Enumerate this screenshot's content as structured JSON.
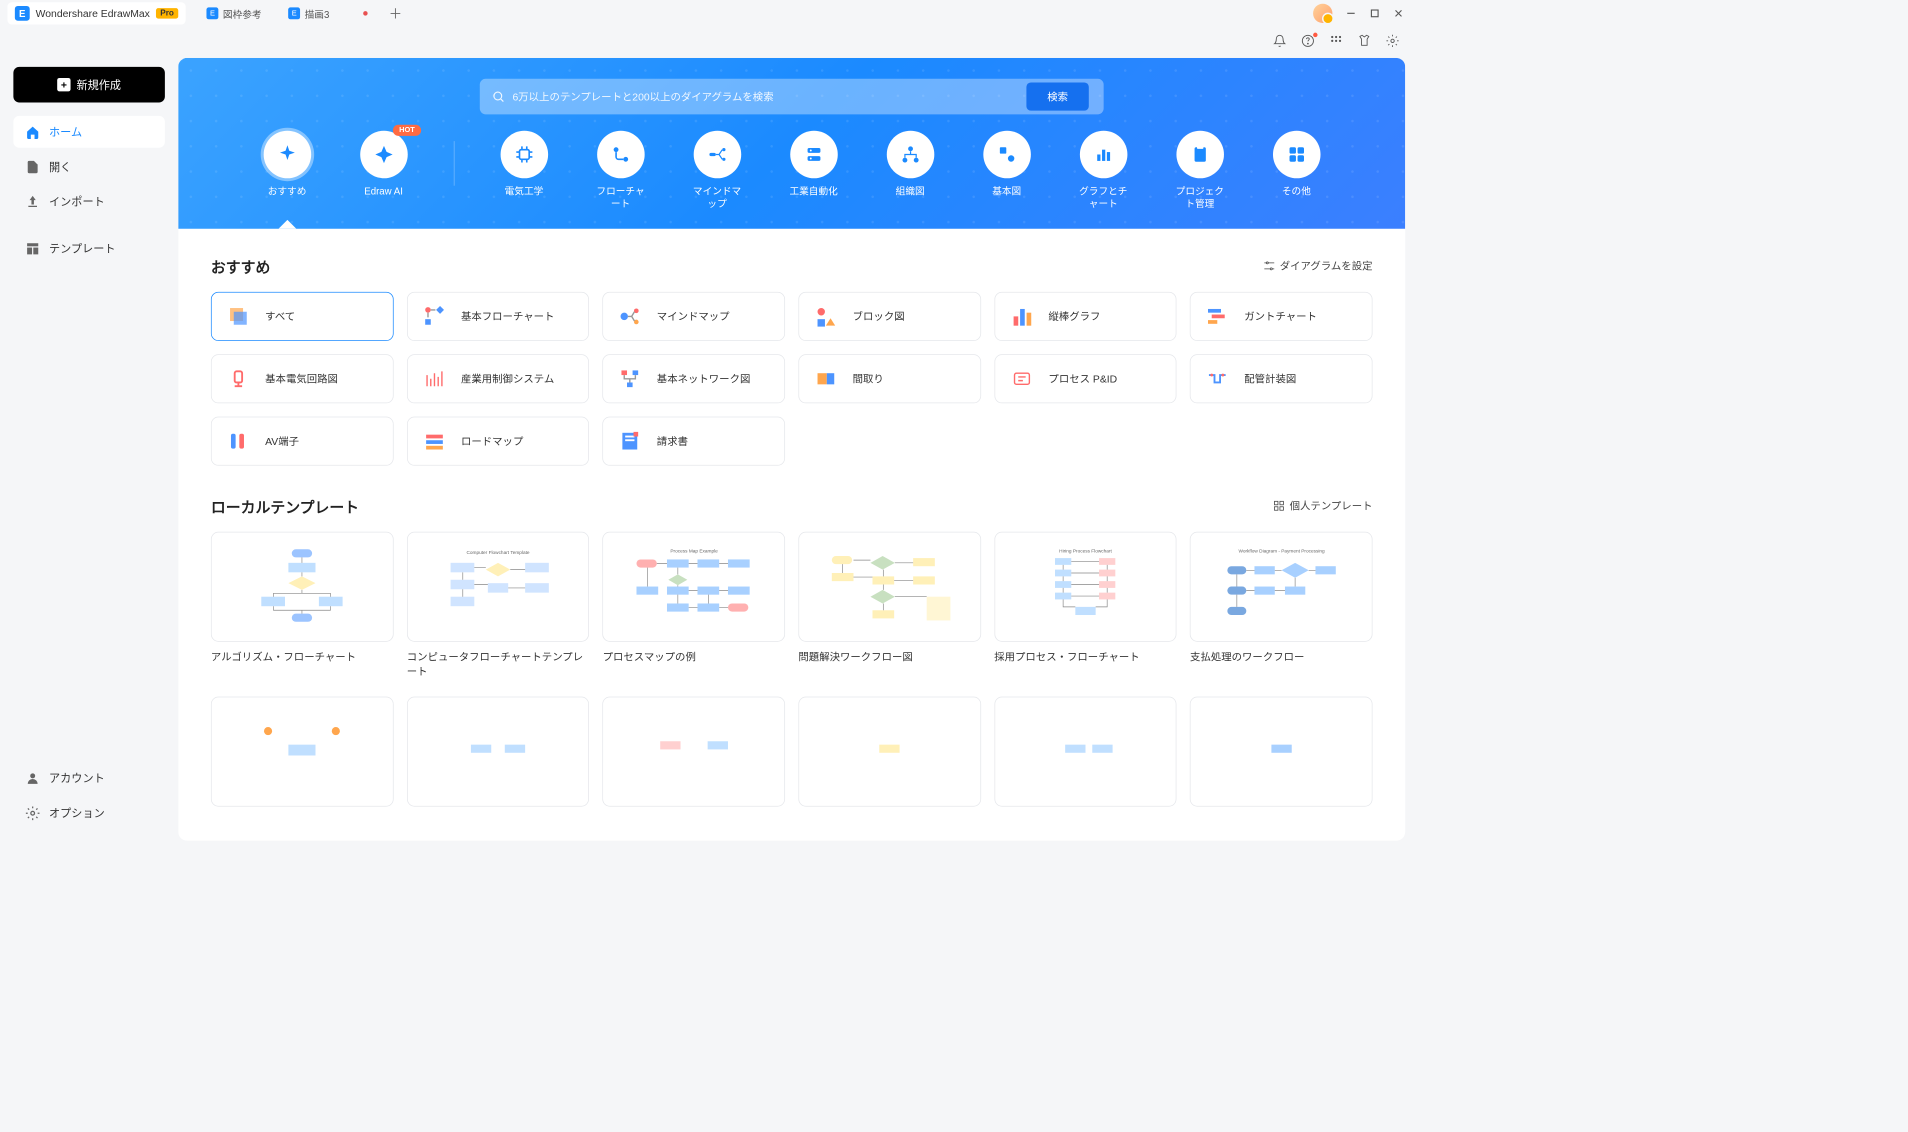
{
  "titlebar": {
    "app_name": "Wondershare EdrawMax",
    "pro": "Pro",
    "tabs": [
      {
        "label": "図枠参考"
      },
      {
        "label": "描画3",
        "unsaved": true
      }
    ]
  },
  "sidebar": {
    "new_label": "新規作成",
    "nav": {
      "home": "ホーム",
      "open": "開く",
      "import": "インポート",
      "template": "テンプレート"
    },
    "footer": {
      "account": "アカウント",
      "options": "オプション"
    }
  },
  "hero": {
    "search_placeholder": "6万以上のテンプレートと200以上のダイアグラムを検索",
    "search_btn": "検索",
    "hot_badge": "HOT",
    "categories": {
      "recommend": "おすすめ",
      "ai": "Edraw AI",
      "electric": "電気工学",
      "flowchart": "フローチャート",
      "mindmap": "マインドマップ",
      "automation": "工業自動化",
      "orgchart": "組織図",
      "basic": "基本図",
      "graphs": "グラフとチャート",
      "project": "プロジェクト管理",
      "other": "その他"
    }
  },
  "sections": {
    "recommend_title": "おすすめ",
    "recommend_link": "ダイアグラムを設定",
    "local_title": "ローカルテンプレート",
    "local_link": "個人テンプレート"
  },
  "types": {
    "all": "すべて",
    "basic_flow": "基本フローチャート",
    "mindmap": "マインドマップ",
    "block": "ブロック図",
    "bar": "縦棒グラフ",
    "gantt": "ガントチャート",
    "circuit": "基本電気回路図",
    "industrial": "産業用制御システム",
    "network": "基本ネットワーク図",
    "floorplan": "間取り",
    "process_pid": "プロセス P&ID",
    "piping": "配管計装図",
    "av": "AV端子",
    "roadmap": "ロードマップ",
    "invoice": "請求書"
  },
  "templates": {
    "algo": "アルゴリズム・フローチャート",
    "computer": "コンピュータフローチャートテンプレート",
    "process_map": "プロセスマップの例",
    "problem": "問題解決ワークフロー図",
    "hiring": "採用プロセス・フローチャート",
    "payment": "支払処理のワークフロー"
  }
}
